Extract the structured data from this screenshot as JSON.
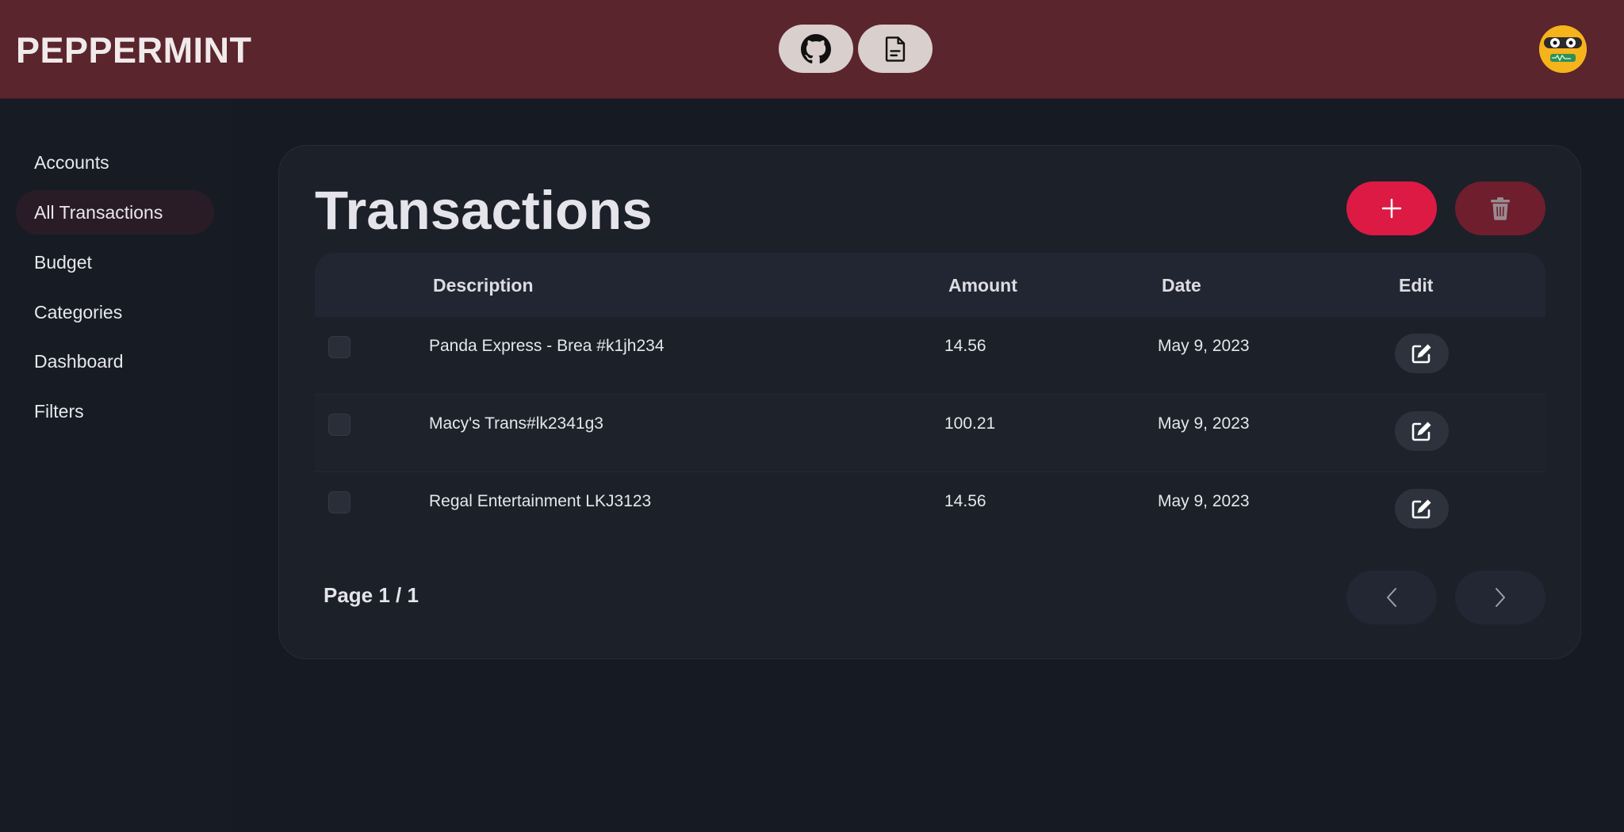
{
  "header": {
    "brand": "PEPPERMINT",
    "icons": [
      "github-icon",
      "document-icon"
    ]
  },
  "sidebar": {
    "items": [
      {
        "label": "Accounts"
      },
      {
        "label": "All Transactions",
        "active": true
      },
      {
        "label": "Budget"
      },
      {
        "label": "Categories"
      },
      {
        "label": "Dashboard"
      },
      {
        "label": "Filters"
      }
    ]
  },
  "main": {
    "title": "Transactions",
    "columns": {
      "description": "Description",
      "amount": "Amount",
      "date": "Date",
      "edit": "Edit"
    },
    "rows": [
      {
        "description": "Panda Express - Brea #k1jh234",
        "amount": "14.56",
        "date": "May 9, 2023"
      },
      {
        "description": "Macy's Trans#lk2341g3",
        "amount": "100.21",
        "date": "May 9, 2023"
      },
      {
        "description": "Regal Entertainment LKJ3123",
        "amount": "14.56",
        "date": "May 9, 2023"
      }
    ],
    "pagination": {
      "label": "Page 1 / 1"
    }
  },
  "colors": {
    "header_bg": "#5a252d",
    "accent": "#dc1a44",
    "delete": "#6e1e2d",
    "background": "#171b24"
  }
}
